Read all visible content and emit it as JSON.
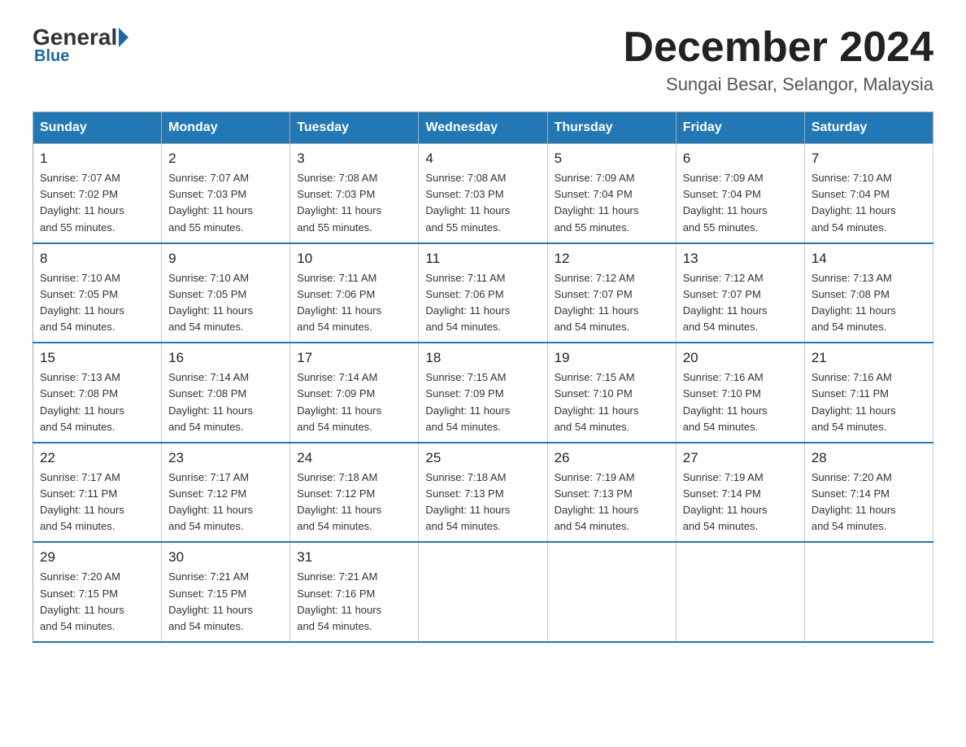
{
  "logo": {
    "general": "General",
    "blue": "Blue"
  },
  "header": {
    "title": "December 2024",
    "subtitle": "Sungai Besar, Selangor, Malaysia"
  },
  "days_of_week": [
    "Sunday",
    "Monday",
    "Tuesday",
    "Wednesday",
    "Thursday",
    "Friday",
    "Saturday"
  ],
  "weeks": [
    [
      {
        "day": "1",
        "sunrise": "7:07 AM",
        "sunset": "7:02 PM",
        "daylight": "11 hours and 55 minutes."
      },
      {
        "day": "2",
        "sunrise": "7:07 AM",
        "sunset": "7:03 PM",
        "daylight": "11 hours and 55 minutes."
      },
      {
        "day": "3",
        "sunrise": "7:08 AM",
        "sunset": "7:03 PM",
        "daylight": "11 hours and 55 minutes."
      },
      {
        "day": "4",
        "sunrise": "7:08 AM",
        "sunset": "7:03 PM",
        "daylight": "11 hours and 55 minutes."
      },
      {
        "day": "5",
        "sunrise": "7:09 AM",
        "sunset": "7:04 PM",
        "daylight": "11 hours and 55 minutes."
      },
      {
        "day": "6",
        "sunrise": "7:09 AM",
        "sunset": "7:04 PM",
        "daylight": "11 hours and 55 minutes."
      },
      {
        "day": "7",
        "sunrise": "7:10 AM",
        "sunset": "7:04 PM",
        "daylight": "11 hours and 54 minutes."
      }
    ],
    [
      {
        "day": "8",
        "sunrise": "7:10 AM",
        "sunset": "7:05 PM",
        "daylight": "11 hours and 54 minutes."
      },
      {
        "day": "9",
        "sunrise": "7:10 AM",
        "sunset": "7:05 PM",
        "daylight": "11 hours and 54 minutes."
      },
      {
        "day": "10",
        "sunrise": "7:11 AM",
        "sunset": "7:06 PM",
        "daylight": "11 hours and 54 minutes."
      },
      {
        "day": "11",
        "sunrise": "7:11 AM",
        "sunset": "7:06 PM",
        "daylight": "11 hours and 54 minutes."
      },
      {
        "day": "12",
        "sunrise": "7:12 AM",
        "sunset": "7:07 PM",
        "daylight": "11 hours and 54 minutes."
      },
      {
        "day": "13",
        "sunrise": "7:12 AM",
        "sunset": "7:07 PM",
        "daylight": "11 hours and 54 minutes."
      },
      {
        "day": "14",
        "sunrise": "7:13 AM",
        "sunset": "7:08 PM",
        "daylight": "11 hours and 54 minutes."
      }
    ],
    [
      {
        "day": "15",
        "sunrise": "7:13 AM",
        "sunset": "7:08 PM",
        "daylight": "11 hours and 54 minutes."
      },
      {
        "day": "16",
        "sunrise": "7:14 AM",
        "sunset": "7:08 PM",
        "daylight": "11 hours and 54 minutes."
      },
      {
        "day": "17",
        "sunrise": "7:14 AM",
        "sunset": "7:09 PM",
        "daylight": "11 hours and 54 minutes."
      },
      {
        "day": "18",
        "sunrise": "7:15 AM",
        "sunset": "7:09 PM",
        "daylight": "11 hours and 54 minutes."
      },
      {
        "day": "19",
        "sunrise": "7:15 AM",
        "sunset": "7:10 PM",
        "daylight": "11 hours and 54 minutes."
      },
      {
        "day": "20",
        "sunrise": "7:16 AM",
        "sunset": "7:10 PM",
        "daylight": "11 hours and 54 minutes."
      },
      {
        "day": "21",
        "sunrise": "7:16 AM",
        "sunset": "7:11 PM",
        "daylight": "11 hours and 54 minutes."
      }
    ],
    [
      {
        "day": "22",
        "sunrise": "7:17 AM",
        "sunset": "7:11 PM",
        "daylight": "11 hours and 54 minutes."
      },
      {
        "day": "23",
        "sunrise": "7:17 AM",
        "sunset": "7:12 PM",
        "daylight": "11 hours and 54 minutes."
      },
      {
        "day": "24",
        "sunrise": "7:18 AM",
        "sunset": "7:12 PM",
        "daylight": "11 hours and 54 minutes."
      },
      {
        "day": "25",
        "sunrise": "7:18 AM",
        "sunset": "7:13 PM",
        "daylight": "11 hours and 54 minutes."
      },
      {
        "day": "26",
        "sunrise": "7:19 AM",
        "sunset": "7:13 PM",
        "daylight": "11 hours and 54 minutes."
      },
      {
        "day": "27",
        "sunrise": "7:19 AM",
        "sunset": "7:14 PM",
        "daylight": "11 hours and 54 minutes."
      },
      {
        "day": "28",
        "sunrise": "7:20 AM",
        "sunset": "7:14 PM",
        "daylight": "11 hours and 54 minutes."
      }
    ],
    [
      {
        "day": "29",
        "sunrise": "7:20 AM",
        "sunset": "7:15 PM",
        "daylight": "11 hours and 54 minutes."
      },
      {
        "day": "30",
        "sunrise": "7:21 AM",
        "sunset": "7:15 PM",
        "daylight": "11 hours and 54 minutes."
      },
      {
        "day": "31",
        "sunrise": "7:21 AM",
        "sunset": "7:16 PM",
        "daylight": "11 hours and 54 minutes."
      },
      null,
      null,
      null,
      null
    ]
  ],
  "labels": {
    "sunrise": "Sunrise: ",
    "sunset": "Sunset: ",
    "daylight": "Daylight: "
  }
}
